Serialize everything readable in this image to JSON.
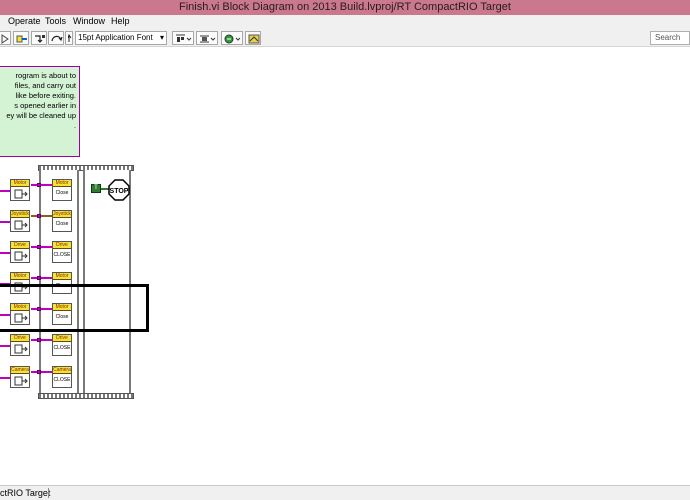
{
  "window": {
    "title": "Finish.vi Block Diagram on 2013 Build.lvproj/RT CompactRIO Target"
  },
  "menu": {
    "items": [
      "Operate",
      "Tools",
      "Window",
      "Help"
    ]
  },
  "toolbar": {
    "font_label": "15pt Application Font",
    "search_placeholder": "Search",
    "icons": [
      "run-icon",
      "retain-wire-values-icon",
      "step-into-icon",
      "text-settings-icon",
      "align-icon",
      "distribute-icon",
      "reorder-icon",
      "cleanup-icon"
    ]
  },
  "comment": {
    "lines": [
      "rogram is about to",
      "",
      "files, and carry out",
      "like before exiting.",
      "s opened earlier in",
      "ey will be cleaned up",
      "."
    ]
  },
  "diagram": {
    "left_column": [
      "Motor",
      "Joystick",
      "Drive",
      "Motor",
      "Motor",
      "Drive",
      "Camera"
    ],
    "right_column": [
      {
        "header": "Motor",
        "body": "Close"
      },
      {
        "header": "Joystick",
        "body": "Close"
      },
      {
        "header": "Drive",
        "body": "CLOSE"
      },
      {
        "header": "Motor",
        "body": "Close"
      },
      {
        "header": "Motor",
        "body": "Close"
      },
      {
        "header": "Drive",
        "body": "CLOSE"
      },
      {
        "header": "Camera",
        "body": "CLOSE"
      }
    ],
    "boolean_constant": "T",
    "stop_label": "STOP"
  },
  "status": {
    "target": "ctRIO Target"
  },
  "colors": {
    "titlebar": "#c9798b",
    "comment_bg": "#d4f3d4",
    "refnum_wire": "#c000c0",
    "node_header": "#f3e23a"
  }
}
